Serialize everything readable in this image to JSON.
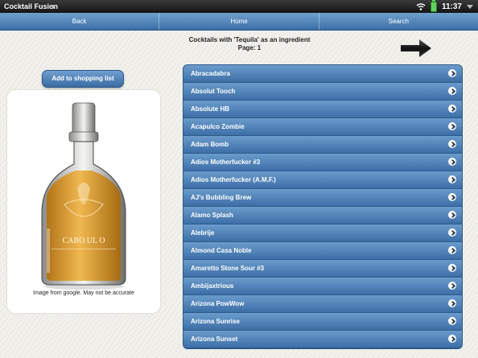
{
  "statusbar": {
    "app_title": "Cocktail Fusion",
    "time": "11:37"
  },
  "nav": {
    "back": "Back",
    "home": "Home",
    "search": "Search"
  },
  "header": {
    "title": "Cocktails with 'Tequila' as an ingredient",
    "page": "Page: 1"
  },
  "sidebar": {
    "shopping_button": "Add to shopping list",
    "image_caption": "Image from google. May not be accurate",
    "bottle_label": "CABO UL O"
  },
  "cocktails": [
    "Abracadabra",
    "Absolut Tooch",
    "Absolute HB",
    "Acapulco Zombie",
    "Adam Bomb",
    "Adios Motherfucker #3",
    "Adios Motherfucker (A.M.F.)",
    "AJ's Bubbling Brew",
    "Alamo Splash",
    "Alebrije",
    "Almond Casa Noble",
    "Amaretto Stone Sour #3",
    "Ambijaxtrious",
    "Arizona PowWow",
    "Arizona Sunrise",
    "Arizona Sunset"
  ]
}
